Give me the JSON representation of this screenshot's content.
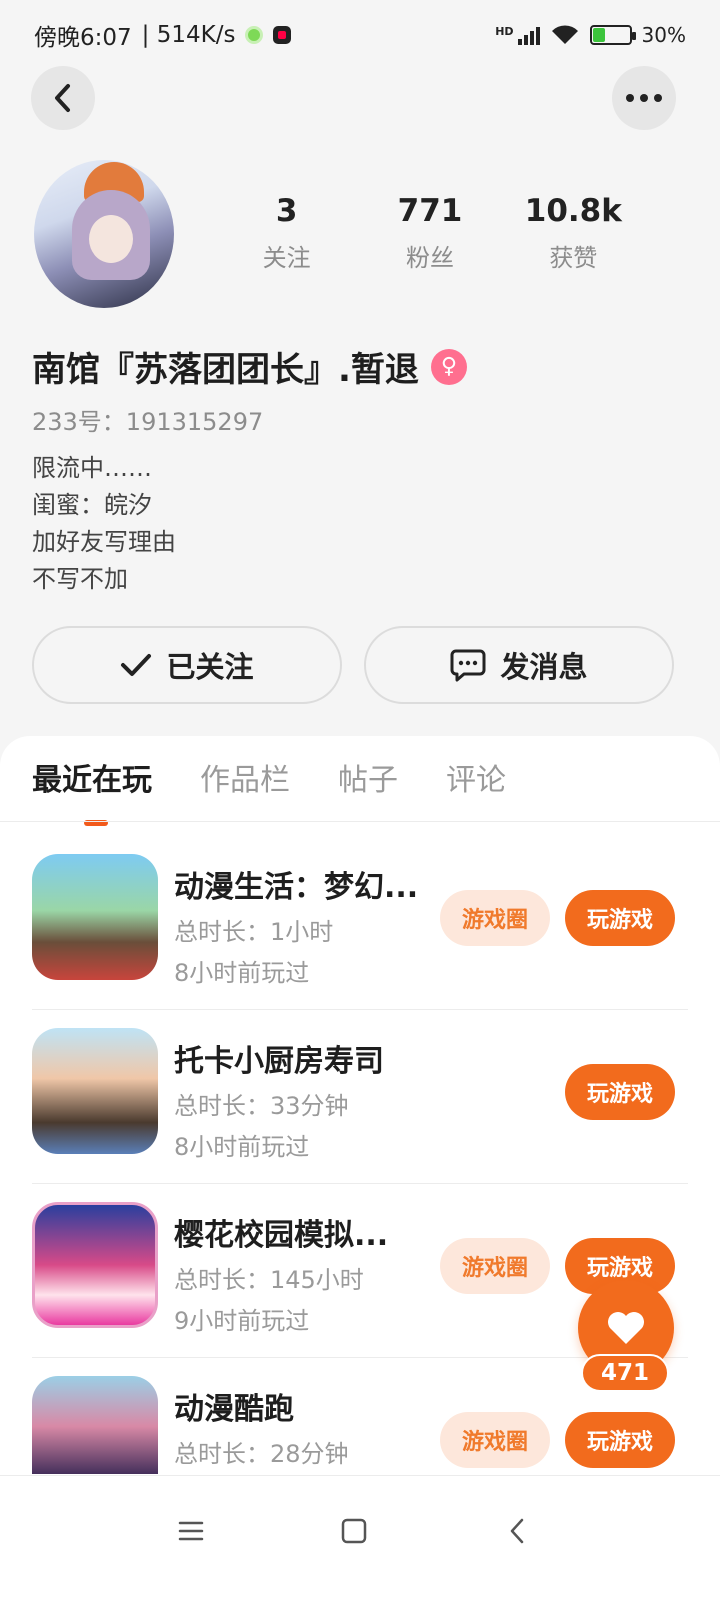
{
  "status_bar": {
    "time": "傍晚6:07",
    "speed": "| 514K/s",
    "network": "HD",
    "battery": "30%"
  },
  "header": {
    "back_icon": "chevron-left-icon",
    "more_icon": "more-dots-icon"
  },
  "profile": {
    "stats": [
      {
        "value": "3",
        "label": "关注"
      },
      {
        "value": "771",
        "label": "粉丝"
      },
      {
        "value": "10.8k",
        "label": "获赞"
      }
    ],
    "name": "南馆『苏落团团长』.暂退",
    "gender_icon": "female-icon",
    "uid": "233号：191315297",
    "bio": [
      "限流中……",
      "闺蜜：皖汐",
      "加好友写理由",
      "不写不加"
    ],
    "follow_label": "已关注",
    "message_label": "发消息"
  },
  "tabs": [
    "最近在玩",
    "作品栏",
    "帖子",
    "评论"
  ],
  "games": [
    {
      "title": "动漫生活：梦幻...",
      "time": "总时长：1小时",
      "last": "8小时前玩过",
      "circle": "游戏圈",
      "play": "玩游戏"
    },
    {
      "title": "托卡小厨房寿司",
      "time": "总时长：33分钟",
      "last": "8小时前玩过",
      "circle": "",
      "play": "玩游戏"
    },
    {
      "title": "樱花校园模拟...",
      "time": "总时长：145小时",
      "last": "9小时前玩过",
      "circle": "游戏圈",
      "play": "玩游戏"
    },
    {
      "title": "动漫酷跑",
      "time": "总时长：28分钟",
      "last": "",
      "circle": "游戏圈",
      "play": "玩游戏"
    }
  ],
  "like_fab": {
    "count": "471"
  },
  "colors": {
    "accent": "#f26b1d",
    "accent_light": "#fde7db",
    "gender": "#ff6f8f"
  }
}
